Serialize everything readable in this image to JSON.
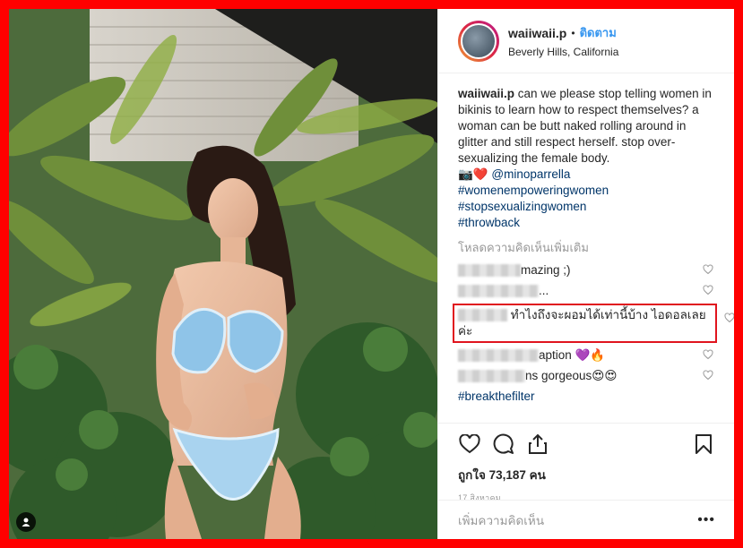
{
  "post": {
    "username": "waiiwaii.p",
    "separator": "•",
    "follow_label": "ติดตาม",
    "location": "Beverly Hills, California"
  },
  "caption": {
    "username": "waiiwaii.p",
    "text": "can we please stop telling women in bikinis to learn how to respect themselves? a woman can be butt naked rolling around in glitter and still respect herself. stop over-sexualizing the female body.",
    "credit_emoji": "📷❤️",
    "credit_mention": "@minoparrella",
    "hashtags": [
      "#womenempoweringwomen",
      "#stopsexualizingwomen",
      "#throwback"
    ]
  },
  "load_more_label": "โหลดความคิดเห็นเพิ่มเติม",
  "comments": [
    {
      "text": "mazing ;)"
    },
    {
      "text": "..."
    },
    {
      "text": "ทำไงถึงจะผอมได้เท่านี้บ้าง ไอดอลเลยค่ะ"
    },
    {
      "text": "aption 💜🔥"
    },
    {
      "text": "ns gorgeous😍😍"
    },
    {
      "text": "#breakthefilter"
    }
  ],
  "likes_label": "ถูกใจ 73,187 คน",
  "date_label": "17 สิงหาคม",
  "add_comment_placeholder": "เพิ่มความคิดเห็น",
  "more_options": "•••",
  "colors": {
    "border_frame": "#ff0000",
    "highlight_box": "#e0141e",
    "link_blue": "#3897f0",
    "hashtag": "#003569"
  },
  "icons": [
    "user-tag-icon",
    "heart-icon",
    "comment-icon",
    "share-icon",
    "bookmark-icon",
    "small-heart-icon",
    "more-options-icon"
  ]
}
